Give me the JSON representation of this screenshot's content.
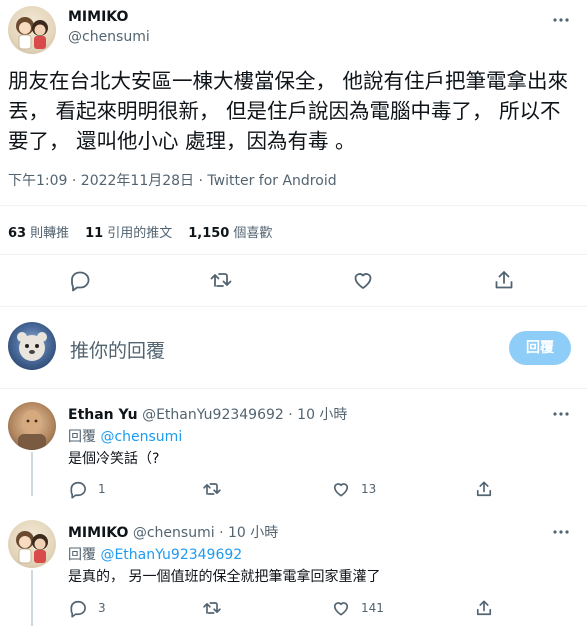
{
  "tweet": {
    "author_name": "MIMIKO",
    "author_handle": "@chensumi",
    "text": "朋友在台北大安區一棟大樓當保全， 他說有住戶把筆電拿出來丟， 看起來明明很新， 但是住戶說因為電腦中毒了， 所以不要了， 還叫他小心 處理，因為有毒 。",
    "meta": "下午1:09 · 2022年11月28日 · Twitter for Android",
    "stats": {
      "retweets_count": "63",
      "retweets_label": "則轉推",
      "quotes_count": "11",
      "quotes_label": "引用的推文",
      "likes_count": "1,150",
      "likes_label": "個喜歡"
    }
  },
  "compose": {
    "placeholder": "推你的回覆",
    "button": "回覆"
  },
  "replies": [
    {
      "name": "Ethan Yu",
      "handle": "@EthanYu92349692",
      "time": "· 10 小時",
      "replying_label": "回覆",
      "replying_to": "@chensumi",
      "text": "是個冷笑話（?",
      "reply_count": "1",
      "retweet_count": "",
      "like_count": "13"
    },
    {
      "name": "MIMIKO",
      "handle": "@chensumi",
      "time": "· 10 小時",
      "replying_label": "回覆",
      "replying_to": "@EthanYu92349692",
      "text": "是真的， 另一個值班的保全就把筆電拿回家重灌了",
      "reply_count": "3",
      "retweet_count": "",
      "like_count": "141"
    }
  ],
  "icons": {
    "reply": "comment-icon",
    "retweet": "retweet-icon",
    "like": "heart-icon",
    "share": "share-icon",
    "more": "more-icon"
  },
  "colors": {
    "accent": "#1d9bf0",
    "button_disabled": "#8ecdf8",
    "muted_text": "#536471",
    "divider": "#eff3f4"
  }
}
